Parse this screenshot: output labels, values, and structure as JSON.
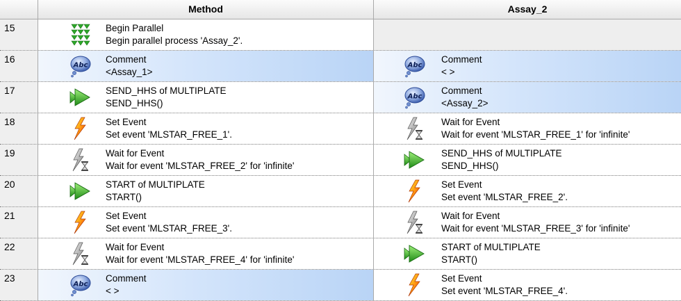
{
  "header": {
    "method_label": "Method",
    "assay_label": "Assay_2"
  },
  "rows": [
    {
      "num": "15",
      "method": {
        "icon": "parallel-icon",
        "title": "Begin Parallel",
        "detail": "Begin parallel process 'Assay_2'.",
        "highlight": false
      },
      "assay": null
    },
    {
      "num": "16",
      "method": {
        "icon": "comment-icon",
        "title": "Comment",
        "detail": "<Assay_1>",
        "highlight": true
      },
      "assay": {
        "icon": "comment-icon",
        "title": "Comment",
        "detail": "< >",
        "highlight": true
      }
    },
    {
      "num": "17",
      "method": {
        "icon": "send-arrow-icon",
        "title": "SEND_HHS of MULTIPLATE",
        "detail": "SEND_HHS()",
        "highlight": false
      },
      "assay": {
        "icon": "comment-icon",
        "title": "Comment",
        "detail": "<Assay_2>",
        "highlight": true
      }
    },
    {
      "num": "18",
      "method": {
        "icon": "set-event-icon",
        "title": "Set Event",
        "detail": "Set event 'MLSTAR_FREE_1'.",
        "highlight": false
      },
      "assay": {
        "icon": "wait-event-icon",
        "title": "Wait for Event",
        "detail": "Wait for event 'MLSTAR_FREE_1' for 'infinite'",
        "highlight": false
      }
    },
    {
      "num": "19",
      "method": {
        "icon": "wait-event-icon",
        "title": "Wait for Event",
        "detail": "Wait for event 'MLSTAR_FREE_2' for 'infinite'",
        "highlight": false
      },
      "assay": {
        "icon": "send-arrow-icon",
        "title": "SEND_HHS of MULTIPLATE",
        "detail": "SEND_HHS()",
        "highlight": false
      }
    },
    {
      "num": "20",
      "method": {
        "icon": "send-arrow-icon",
        "title": "START of MULTIPLATE",
        "detail": "START()",
        "highlight": false
      },
      "assay": {
        "icon": "set-event-icon",
        "title": "Set Event",
        "detail": "Set event 'MLSTAR_FREE_2'.",
        "highlight": false
      }
    },
    {
      "num": "21",
      "method": {
        "icon": "set-event-icon",
        "title": "Set Event",
        "detail": "Set event 'MLSTAR_FREE_3'.",
        "highlight": false
      },
      "assay": {
        "icon": "wait-event-icon",
        "title": "Wait for Event",
        "detail": "Wait for event 'MLSTAR_FREE_3' for 'infinite'",
        "highlight": false
      }
    },
    {
      "num": "22",
      "method": {
        "icon": "wait-event-icon",
        "title": "Wait for Event",
        "detail": "Wait for event 'MLSTAR_FREE_4' for 'infinite'",
        "highlight": false
      },
      "assay": {
        "icon": "send-arrow-icon",
        "title": "START of MULTIPLATE",
        "detail": "START()",
        "highlight": false
      }
    },
    {
      "num": "23",
      "method": {
        "icon": "comment-icon",
        "title": "Comment",
        "detail": "< >",
        "highlight": true
      },
      "assay": {
        "icon": "set-event-icon",
        "title": "Set Event",
        "detail": "Set event 'MLSTAR_FREE_4'.",
        "highlight": false
      }
    }
  ]
}
